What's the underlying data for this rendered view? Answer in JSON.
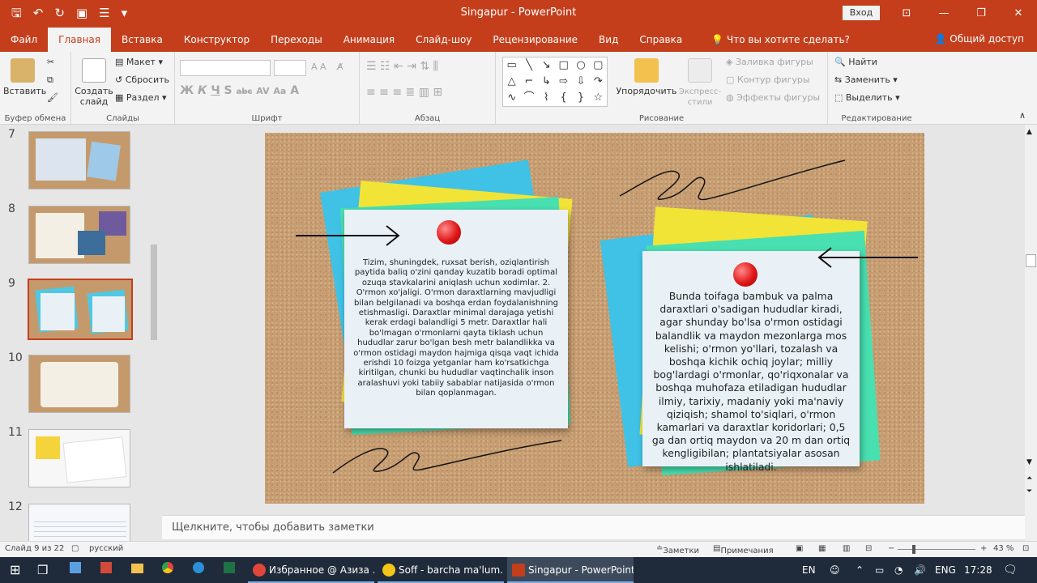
{
  "window": {
    "title": "Singapur - PowerPoint",
    "signin": "Вход",
    "accent": "#c43e1c"
  },
  "tabs": [
    {
      "label": "Файл",
      "active": false
    },
    {
      "label": "Главная",
      "active": true
    },
    {
      "label": "Вставка",
      "active": false
    },
    {
      "label": "Конструктор",
      "active": false
    },
    {
      "label": "Переходы",
      "active": false
    },
    {
      "label": "Анимация",
      "active": false
    },
    {
      "label": "Слайд-шоу",
      "active": false
    },
    {
      "label": "Рецензирование",
      "active": false
    },
    {
      "label": "Вид",
      "active": false
    },
    {
      "label": "Справка",
      "active": false
    }
  ],
  "tellme": "Что вы хотите сделать?",
  "share": "Общий доступ",
  "ribbon": {
    "clipboard": {
      "paste": "Вставить",
      "label": "Буфер обмена"
    },
    "slides": {
      "new_slide": "Создать слайд",
      "layout": "Макет",
      "reset": "Сбросить",
      "section": "Раздел",
      "label": "Слайды"
    },
    "font": {
      "label": "Шрифт",
      "bold": "Ж",
      "italic": "К",
      "underline": "Ч",
      "shadow": "S",
      "strike": "abc",
      "spacing": "AV",
      "case": "Aa"
    },
    "paragraph": {
      "label": "Абзац"
    },
    "drawing": {
      "arrange": "Упорядочить",
      "quick_styles": "Экспресс-стили",
      "fill": "Заливка фигуры",
      "outline": "Контур фигуры",
      "effects": "Эффекты фигуры",
      "label": "Рисование"
    },
    "editing": {
      "find": "Найти",
      "replace": "Заменить",
      "select": "Выделить",
      "label": "Редактирование"
    }
  },
  "thumbnails": [
    {
      "num": "7",
      "selected": false
    },
    {
      "num": "8",
      "selected": false
    },
    {
      "num": "9",
      "selected": true
    },
    {
      "num": "10",
      "selected": false
    },
    {
      "num": "11",
      "selected": false
    },
    {
      "num": "12",
      "selected": false
    }
  ],
  "slide": {
    "note_left": "Tizim, shuningdek, ruxsat berish, oziqlantirish paytida baliq o'zini qanday kuzatib boradi optimal ozuqa stavkalarini aniqlash uchun xodimlar. 2. O'rmon xo'jaligi. O'rmon daraxtlarning mavjudligi bilan belgilanadi va boshqa erdan foydalanishning etishmasligi. Daraxtlar minimal darajaga yetishi kerak erdagi balandligi 5 metr. Daraxtlar hali bo'lmagan o'rmonlarni qayta tiklash uchun hududlar zarur bo'lgan besh metr balandlikka va o'rmon ostidagi maydon hajmiga qisqa vaqt ichida erishdi 10 foizga yetganlar ham ko'rsatkichga kiritilgan, chunki bu hududlar vaqtinchalik inson aralashuvi yoki tabiiy sabablar natijasida o'rmon bilan qoplanmagan.",
    "note_right": "Bunda toifaga bambuk va palma daraxtlari o'sadigan hududlar kiradi, agar shunday bo'lsa o'rmon ostidagi balandlik va maydon mezonlarga mos kelishi; o'rmon yo'llari, tozalash va boshqa kichik ochiq joylar; milliy bog'lardagi o'rmonlar, qo'riqxonalar va boshqa muhofaza etiladigan hududlar ilmiy, tarixiy, madaniy yoki ma'naviy qiziqish; shamol to'siqlari, o'rmon kamarlari va daraxtlar koridorlari; 0,5 ga dan ortiq maydon va 20 m dan ortiq kengligibilan; plantatsiyalar asosan ishlatiladi."
  },
  "notes_placeholder": "Щелкните, чтобы добавить заметки",
  "status": {
    "slide_of": "Слайд 9 из 22",
    "language": "русский",
    "notes": "Заметки",
    "comments": "Примечания",
    "zoom": "43 %"
  },
  "taskbar": {
    "apps": [
      {
        "label": "Избранное @ Азиза ...",
        "color": "#e2463b",
        "active": false
      },
      {
        "label": "Soff - barcha ma'lum...",
        "color": "#f5c518",
        "active": false
      },
      {
        "label": "Singapur - PowerPoint",
        "color": "#c43e1c",
        "active": true
      }
    ],
    "lang1": "EN",
    "lang2": "ENG",
    "time": "17:28"
  }
}
